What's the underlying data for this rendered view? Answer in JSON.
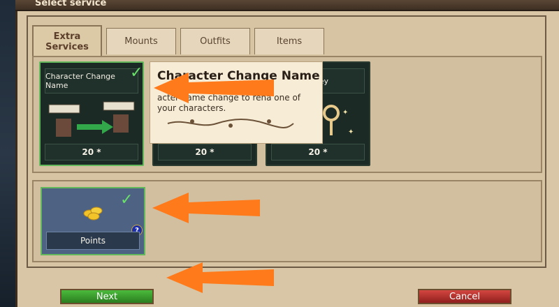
{
  "window": {
    "title": "Select service"
  },
  "tabs": [
    {
      "label": "Extra Services",
      "active": true
    },
    {
      "label": "Mounts",
      "active": false
    },
    {
      "label": "Outfits",
      "active": false
    },
    {
      "label": "Items",
      "active": false
    }
  ],
  "services": [
    {
      "name": "Character Change Name",
      "price": "20 *",
      "selected": true
    },
    {
      "name": "",
      "price": "20 *",
      "selected": false
    },
    {
      "name": "y Key",
      "price": "20 *",
      "selected": false
    }
  ],
  "tooltip": {
    "title": "Character Change Name",
    "text": "acter name change to rena one of your characters."
  },
  "payment": {
    "label": "Points",
    "selected": true,
    "help_icon": "?"
  },
  "buttons": {
    "next": "Next",
    "cancel": "Cancel"
  },
  "colors": {
    "accent_orange": "#ff7a1a",
    "selected_green": "#62b85a",
    "check_green": "#6ae06a"
  }
}
